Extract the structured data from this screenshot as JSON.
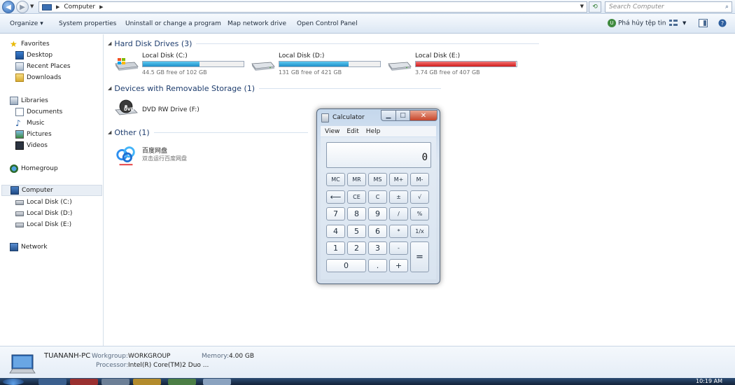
{
  "address": {
    "crumb": "Computer",
    "search_placeholder": "Search Computer"
  },
  "toolbar": {
    "organize": "Organize",
    "system_properties": "System properties",
    "uninstall": "Uninstall or change a program",
    "map_drive": "Map network drive",
    "control_panel": "Open Control Panel",
    "user_label": "Phá hủy tệp tin"
  },
  "nav": {
    "favorites": "Favorites",
    "desktop": "Desktop",
    "recent_places": "Recent Places",
    "downloads": "Downloads",
    "libraries": "Libraries",
    "documents": "Documents",
    "music": "Music",
    "pictures": "Pictures",
    "videos": "Videos",
    "homegroup": "Homegroup",
    "computer": "Computer",
    "disk_c": "Local Disk (C:)",
    "disk_d": "Local Disk (D:)",
    "disk_e": "Local Disk (E:)",
    "network": "Network"
  },
  "groups": {
    "hdd": "Hard Disk Drives (3)",
    "removable": "Devices with Removable Storage (1)",
    "other": "Other (1)"
  },
  "drives": [
    {
      "name": "Local Disk (C:)",
      "free_text": "44.5 GB free of 102 GB",
      "used_fraction": 0.564,
      "color": "#1f8fc9"
    },
    {
      "name": "Local Disk (D:)",
      "free_text": "131 GB free of 421 GB",
      "used_fraction": 0.689,
      "color": "#1f8fc9"
    },
    {
      "name": "Local Disk (E:)",
      "free_text": "3.74 GB free of 407 GB",
      "used_fraction": 0.991,
      "color": "#d01c1c"
    }
  ],
  "dvd": {
    "name": "DVD RW Drive (F:)",
    "badge": "DVD"
  },
  "other": {
    "name": "百度网盘",
    "subtitle": "双击运行百度网盘"
  },
  "details": {
    "pc_name": "TUANANH-PC",
    "workgroup_label": "Workgroup:",
    "workgroup_value": "WORKGROUP",
    "memory_label": "Memory:",
    "memory_value": "4.00 GB",
    "processor_label": "Processor:",
    "processor_value": "Intel(R) Core(TM)2 Duo ..."
  },
  "taskbar": {
    "clock": "10:19 AM"
  },
  "calculator": {
    "title": "Calculator",
    "menu": {
      "view": "View",
      "edit": "Edit",
      "help": "Help"
    },
    "display": "0",
    "buttons": {
      "mc": "MC",
      "mr": "MR",
      "ms": "MS",
      "mplus": "M+",
      "mminus": "M-",
      "back": "⟵",
      "ce": "CE",
      "c": "C",
      "pm": "±",
      "sqrt": "√",
      "n7": "7",
      "n8": "8",
      "n9": "9",
      "div": "/",
      "pct": "%",
      "n4": "4",
      "n5": "5",
      "n6": "6",
      "mul": "*",
      "recip": "1/x",
      "n1": "1",
      "n2": "2",
      "n3": "3",
      "minus": "-",
      "eq": "=",
      "n0": "0",
      "dot": ".",
      "plus": "+"
    }
  }
}
